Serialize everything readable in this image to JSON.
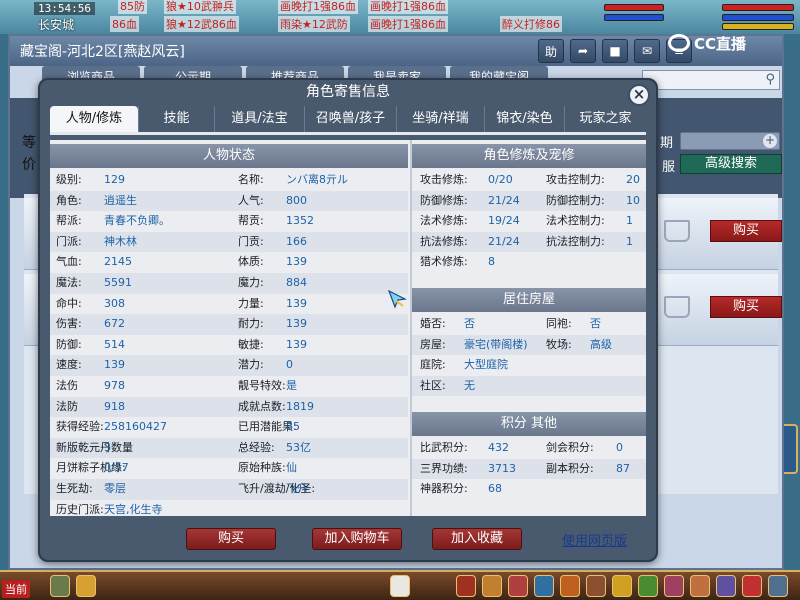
{
  "scene": {
    "clock": "13:54:56",
    "location": "长安城",
    "name_tags": [
      "狼★10武翀兵",
      "狼★12武86血",
      "雨染★12武防",
      "画晚打1强86血",
      "85防",
      "86血",
      "醉义打修86"
    ],
    "chat_tab": "当前",
    "brand": "CC直播"
  },
  "back_window": {
    "title": "藏宝阁-河北2区[燕赵风云]",
    "tabs": [
      "浏览商品",
      "公示期",
      "推荐商品",
      "我是卖家",
      "我的藏宝阁"
    ],
    "row_stub_1": "等",
    "row_stub_2": "价",
    "date_label": "期",
    "clothes_label": "服",
    "advanced_search": "高级搜索",
    "buy_label": "购买"
  },
  "dialog": {
    "title": "角色寄售信息",
    "tabs": [
      "人物/修炼",
      "技能",
      "道具/法宝",
      "召唤兽/孩子",
      "坐骑/祥瑞",
      "锦衣/染色",
      "玩家之家"
    ],
    "active_tab": "人物/修炼",
    "status": {
      "header": "人物状态",
      "rows": [
        {
          "l1": "级别:",
          "v1": "129",
          "l2": "名称:",
          "v2": "ンバ离8亓ル"
        },
        {
          "l1": "角色:",
          "v1": "逍遥生",
          "l2": "人气:",
          "v2": "800"
        },
        {
          "l1": "帮派:",
          "v1": "青春不负卿。",
          "l2": "帮贡:",
          "v2": "1352"
        },
        {
          "l1": "门派:",
          "v1": "神木林",
          "l2": "门贡:",
          "v2": "166"
        },
        {
          "l1": "气血:",
          "v1": "2145",
          "l2": "体质:",
          "v2": "139"
        },
        {
          "l1": "魔法:",
          "v1": "5591",
          "l2": "魔力:",
          "v2": "884"
        },
        {
          "l1": "命中:",
          "v1": "308",
          "l2": "力量:",
          "v2": "139"
        },
        {
          "l1": "伤害:",
          "v1": "672",
          "l2": "耐力:",
          "v2": "139"
        },
        {
          "l1": "防御:",
          "v1": "514",
          "l2": "敏捷:",
          "v2": "139"
        },
        {
          "l1": "速度:",
          "v1": "139",
          "l2": "潜力:",
          "v2": "0"
        },
        {
          "l1": "法伤",
          "v1": "978",
          "l2": "靓号特效:",
          "v2": "是"
        },
        {
          "l1": "法防",
          "v1": "918",
          "l2": "成就点数:",
          "v2": "1819"
        },
        {
          "l1": "获得经验:",
          "v1": "258160427",
          "l2": "已用潜能果:",
          "v2": "85"
        },
        {
          "l1": "新版乾元丹数量",
          "v1": "3",
          "l2": "总经验:",
          "v2": "53亿"
        },
        {
          "l1": "月饼粽子机缘:",
          "v1": "0/57",
          "l2": "原始种族:",
          "v2": "仙"
        },
        {
          "l1": "生死劫:",
          "v1": "零层",
          "l2": "飞升/渡劫/化圣:",
          "v2": "飞升"
        },
        {
          "l1": "历史门派:",
          "v1": "天宫,化生寺",
          "l2": "",
          "v2": ""
        }
      ]
    },
    "cultivation": {
      "header": "角色修炼及宠修",
      "rows": [
        {
          "l1": "攻击修炼:",
          "v1": "0/20",
          "l2": "攻击控制力:",
          "v2": "20"
        },
        {
          "l1": "防御修炼:",
          "v1": "21/24",
          "l2": "防御控制力:",
          "v2": "10"
        },
        {
          "l1": "法术修炼:",
          "v1": "19/24",
          "l2": "法术控制力:",
          "v2": "1"
        },
        {
          "l1": "抗法修炼:",
          "v1": "21/24",
          "l2": "抗法控制力:",
          "v2": "1"
        },
        {
          "l1": "猎术修炼:",
          "v1": "8",
          "l2": "",
          "v2": ""
        }
      ]
    },
    "housing": {
      "header": "居住房屋",
      "rows": [
        {
          "l1": "婚否:",
          "v1": "否",
          "l2": "同袍:",
          "v2": "否"
        },
        {
          "l1": "房屋:",
          "v1": "豪宅(带阁楼)",
          "l2": "牧场:",
          "v2": "高级"
        },
        {
          "l1": "庭院:",
          "v1": "大型庭院",
          "l2": "",
          "v2": ""
        },
        {
          "l1": "社区:",
          "v1": "无",
          "l2": "",
          "v2": ""
        }
      ]
    },
    "points": {
      "header": "积分 其他",
      "rows": [
        {
          "l1": "比武积分:",
          "v1": "432",
          "l2": "剑会积分:",
          "v2": "0"
        },
        {
          "l1": "三界功绩:",
          "v1": "3713",
          "l2": "副本积分:",
          "v2": "87"
        },
        {
          "l1": "神器积分:",
          "v1": "68",
          "l2": "",
          "v2": ""
        }
      ]
    },
    "buttons": {
      "buy": "购买",
      "add_cart": "加入购物车",
      "add_fav": "加入收藏",
      "web_version": "使用网页版"
    }
  }
}
